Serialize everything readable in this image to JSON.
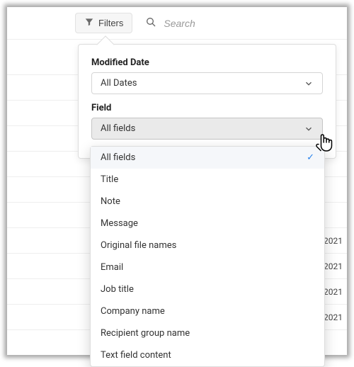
{
  "topbar": {
    "filters_label": "Filters",
    "search_placeholder": "Search"
  },
  "popover": {
    "modified_date": {
      "label": "Modified Date",
      "value": "All Dates"
    },
    "field": {
      "label": "Field",
      "value": "All fields",
      "options": [
        "All fields",
        "Title",
        "Note",
        "Message",
        "Original file names",
        "Email",
        "Job title",
        "Company name",
        "Recipient group name",
        "Text field content"
      ],
      "selected": "All fields"
    }
  },
  "background_rows": {
    "year": "2021"
  }
}
